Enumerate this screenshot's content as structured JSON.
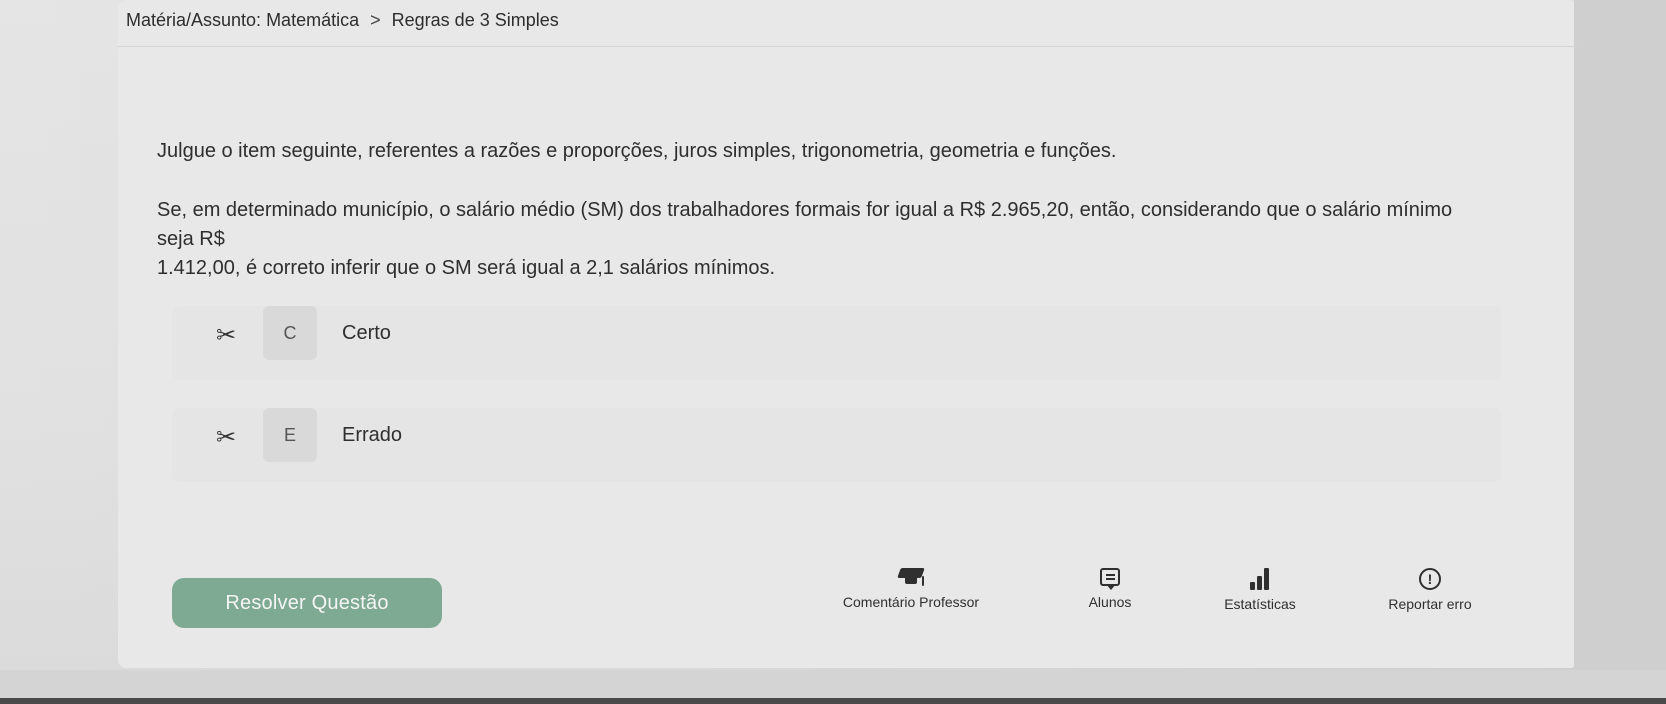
{
  "breadcrumb": {
    "subject": "Matéria/Assunto: Matemática",
    "separator": ">",
    "topic": "Regras de 3 Simples"
  },
  "question": {
    "instruction": "Julgue o item seguinte, referentes a razões e proporções, juros simples, trigonometria, geometria e funções.",
    "statement_line1": "Se, em determinado município, o salário médio (SM) dos trabalhadores formais for igual a R$ 2.965,20, então, considerando que o salário mínimo seja R$",
    "statement_line2": "1.412,00, é correto inferir que o SM será igual a 2,1 salários mínimos."
  },
  "options": [
    {
      "letter": "C",
      "label": "Certo"
    },
    {
      "letter": "E",
      "label": "Errado"
    }
  ],
  "actions": {
    "solve_button": "Resolver Questão",
    "comment_label": "Comentário Professor",
    "students_label": "Alunos",
    "stats_label": "Estatísticas",
    "report_label": "Reportar erro"
  },
  "icons": {
    "scissors": "scissors-icon",
    "comment": "graduation-cap-icon",
    "students": "chat-icon",
    "stats": "bar-chart-icon",
    "report": "alert-icon"
  },
  "colors": {
    "solve_button": "#7ea992",
    "background": "#dcdcdc"
  }
}
